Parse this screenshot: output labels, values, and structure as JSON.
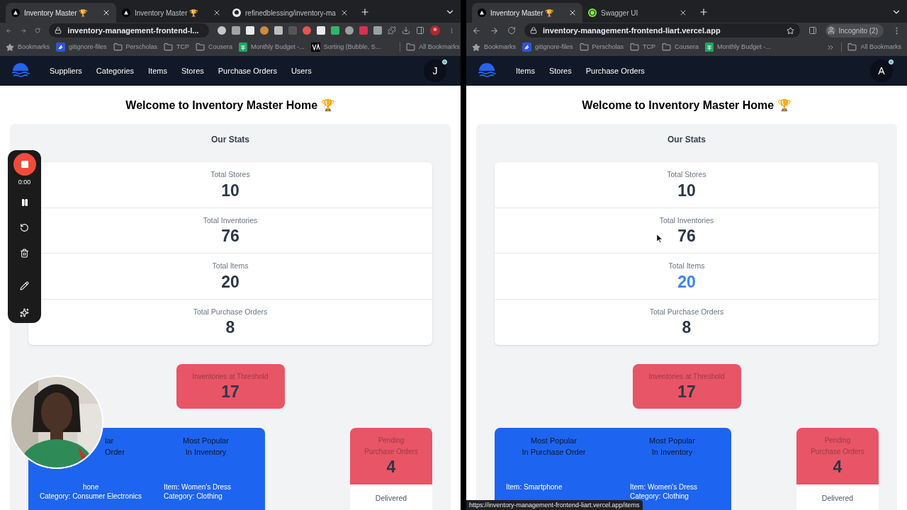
{
  "windows": [
    {
      "tabs": [
        {
          "title": "Inventory Master 🏆",
          "kind": "vercel",
          "selected": true
        },
        {
          "title": "Inventory Master 🏆",
          "kind": "vercel",
          "selected": false
        },
        {
          "title": "refinedblessing/inventory-ma",
          "kind": "github",
          "selected": false
        }
      ],
      "url": "inventory-management-frontend-l...",
      "extensions": true,
      "bookmarks": [
        {
          "label": "Bookmarks",
          "kind": "star"
        },
        {
          "label": "gitignore-files",
          "kind": "app"
        },
        {
          "label": "Perscholas",
          "kind": "folder"
        },
        {
          "label": "TCP",
          "kind": "folder"
        },
        {
          "label": "Cousera",
          "kind": "folder"
        },
        {
          "label": "Monthly Budget -...",
          "kind": "sheet"
        },
        {
          "label": "Sorting (Bubble, S...",
          "kind": "va"
        }
      ],
      "all_bookmarks": "All Bookmarks",
      "nav_links": [
        "Suppliers",
        "Categories",
        "Items",
        "Stores",
        "Purchase Orders",
        "Users"
      ],
      "avatar": "J",
      "page": {
        "heading": "Welcome to Inventory Master Home 🏆",
        "stats_title": "Our Stats",
        "stats": [
          {
            "label": "Total Stores",
            "value": "10",
            "highlighted": false
          },
          {
            "label": "Total Inventories",
            "value": "76",
            "highlighted": false
          },
          {
            "label": "Total Items",
            "value": "20",
            "highlighted": false
          },
          {
            "label": "Total Purchase Orders",
            "value": "8",
            "highlighted": false
          }
        ],
        "threshold": {
          "label": "Inventories at Threshold",
          "value": "17"
        },
        "popular": [
          {
            "title_lines": [
              "lar",
              "Order"
            ],
            "item": "hone",
            "category": "Category: Consumer Electronics",
            "covered": true
          },
          {
            "title_lines": [
              "Most Popular",
              "In Inventory"
            ],
            "item": "Item: Women's Dress",
            "category": "Category: Clothing",
            "covered": false
          }
        ],
        "pending": {
          "label_lines": [
            "Pending",
            "Purchase Orders"
          ],
          "value": "4"
        },
        "delivered": "Delivered"
      },
      "webcam": {
        "kind": "picture"
      }
    },
    {
      "tabs": [
        {
          "title": "Inventory Master 🏆",
          "kind": "vercel",
          "selected": true
        },
        {
          "title": "Swagger UI",
          "kind": "swagger",
          "selected": false
        }
      ],
      "url": "inventory-management-frontend-liart.vercel.app",
      "profile": "Incognito (2)",
      "bookmarks": [
        {
          "label": "Bookmarks",
          "kind": "star"
        },
        {
          "label": "gitignore-files",
          "kind": "app"
        },
        {
          "label": "Perscholas",
          "kind": "folder"
        },
        {
          "label": "TCP",
          "kind": "folder"
        },
        {
          "label": "Cousera",
          "kind": "folder"
        },
        {
          "label": "Monthly Budget -...",
          "kind": "sheet"
        }
      ],
      "all_bookmarks": "All Bookmarks",
      "nav_links": [
        "Items",
        "Stores",
        "Purchase Orders"
      ],
      "avatar": "A",
      "page": {
        "heading": "Welcome to Inventory Master Home 🏆",
        "stats_title": "Our Stats",
        "stats": [
          {
            "label": "Total Stores",
            "value": "10",
            "highlighted": false
          },
          {
            "label": "Total Inventories",
            "value": "76",
            "highlighted": false
          },
          {
            "label": "Total Items",
            "value": "20",
            "highlighted": true
          },
          {
            "label": "Total Purchase Orders",
            "value": "8",
            "highlighted": false
          }
        ],
        "threshold": {
          "label": "Inventories at Threshold",
          "value": "17"
        },
        "popular": [
          {
            "title_lines": [
              "Most Popular",
              "In Purchase Order"
            ],
            "item": "Item: Smartphone",
            "covered": false
          },
          {
            "title_lines": [
              "Most Popular",
              "In Inventory"
            ],
            "item": "Item: Women's Dress",
            "category": "Category: Clothing",
            "covered": false
          }
        ],
        "pending": {
          "label_lines": [
            "Pending",
            "Purchase Orders"
          ],
          "value": "4"
        },
        "delivered": "Delivered"
      },
      "cursor": true,
      "status_url": "https://inventory-management-frontend-liart.vercel.app/items"
    }
  ],
  "recorder": {
    "time": "0:00"
  }
}
